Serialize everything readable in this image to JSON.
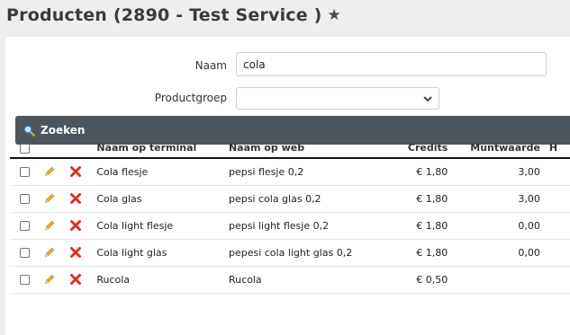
{
  "page": {
    "title": "Producten (2890 - Test Service )",
    "favorite_icon": "star-icon"
  },
  "form": {
    "naam_label": "Naam",
    "naam_value": "cola",
    "productgroep_label": "Productgroep",
    "productgroep_value": ""
  },
  "search": {
    "label": "Zoeken",
    "icon": "magnifier-icon"
  },
  "table": {
    "headers": {
      "terminal": "Naam op terminal",
      "web": "Naam op web",
      "credits": "Credits",
      "muntwaarde": "Muntwaarde",
      "extra": "H"
    },
    "rows": [
      {
        "terminal": "Cola flesje",
        "web": "pepsi flesje 0,2",
        "credits": "€ 1,80",
        "muntwaarde": "3,00"
      },
      {
        "terminal": "Cola glas",
        "web": "pepsi cola glas 0,2",
        "credits": "€ 1,80",
        "muntwaarde": "3,00"
      },
      {
        "terminal": "Cola light flesje",
        "web": "pepsi light flesje 0,2",
        "credits": "€ 1,80",
        "muntwaarde": "0,00"
      },
      {
        "terminal": "Cola light glas",
        "web": "pepesi cola light glas 0,2",
        "credits": "€ 1,80",
        "muntwaarde": "0,00"
      },
      {
        "terminal": "Rucola",
        "web": "Rucola",
        "credits": "€ 0,50",
        "muntwaarde": ""
      }
    ]
  },
  "colors": {
    "search_bar": "#4c555c",
    "edit_icon": "#e8a23a",
    "delete_icon": "#d9321f"
  }
}
